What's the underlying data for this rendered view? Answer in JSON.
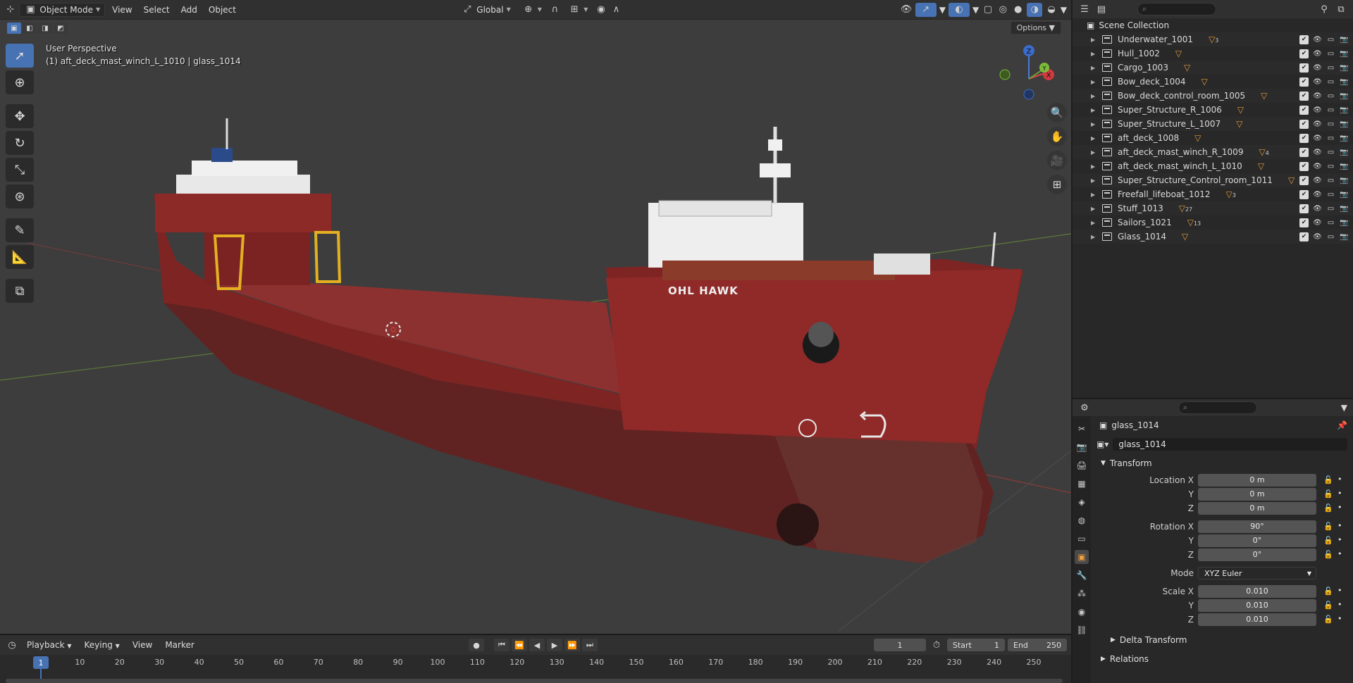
{
  "header": {
    "mode": "Object Mode",
    "menus": [
      "View",
      "Select",
      "Add",
      "Object"
    ],
    "orientation": "Global",
    "options": "Options"
  },
  "viewport": {
    "perspective": "User Perspective",
    "active_info": "(1) aft_deck_mast_winch_L_1010 | glass_1014",
    "ship_name": "OHL HAWK",
    "gizmo": {
      "x": "X",
      "y": "Y",
      "z": "Z"
    }
  },
  "outliner": {
    "search_placeholder": "",
    "root": "Scene Collection",
    "items": [
      {
        "name": "Underwater_1001",
        "count": "3"
      },
      {
        "name": "Hull_1002",
        "count": ""
      },
      {
        "name": "Cargo_1003",
        "count": ""
      },
      {
        "name": "Bow_deck_1004",
        "count": ""
      },
      {
        "name": "Bow_deck_control_room_1005",
        "count": ""
      },
      {
        "name": "Super_Structure_R_1006",
        "count": ""
      },
      {
        "name": "Super_Structure_L_1007",
        "count": ""
      },
      {
        "name": "aft_deck_1008",
        "count": ""
      },
      {
        "name": "aft_deck_mast_winch_R_1009",
        "count": "4"
      },
      {
        "name": "aft_deck_mast_winch_L_1010",
        "count": ""
      },
      {
        "name": "Super_Structure_Control_room_1011",
        "count": ""
      },
      {
        "name": "Freefall_lifeboat_1012",
        "count": "3"
      },
      {
        "name": "Stuff_1013",
        "count": "27"
      },
      {
        "name": "Sailors_1021",
        "count": "13"
      },
      {
        "name": "Glass_1014",
        "count": ""
      }
    ]
  },
  "properties": {
    "object_title": "glass_1014",
    "object_name": "glass_1014",
    "transform_label": "Transform",
    "location": {
      "label": "Location X",
      "x": "0 m",
      "y": "0 m",
      "z": "0 m"
    },
    "rotation": {
      "label": "Rotation X",
      "x": "90°",
      "y": "0°",
      "z": "0°"
    },
    "mode_label": "Mode",
    "mode_value": "XYZ Euler",
    "scale": {
      "label": "Scale X",
      "x": "0.010",
      "y": "0.010",
      "z": "0.010"
    },
    "axis": {
      "y": "Y",
      "z": "Z"
    },
    "delta_transform": "Delta Transform",
    "relations": "Relations"
  },
  "timeline": {
    "menus": [
      "Playback",
      "Keying",
      "View",
      "Marker"
    ],
    "current_frame": "1",
    "start_label": "Start",
    "start": "1",
    "end_label": "End",
    "end": "250",
    "playhead": "1",
    "ticks": [
      "10",
      "20",
      "30",
      "40",
      "50",
      "60",
      "70",
      "80",
      "90",
      "100",
      "110",
      "120",
      "130",
      "140",
      "150",
      "160",
      "170",
      "180",
      "190",
      "200",
      "210",
      "220",
      "230",
      "240",
      "250"
    ]
  },
  "colors": {
    "accent": "#4772b3",
    "hull": "#8a2a28",
    "mesh_icon": "#e39a3c",
    "viewport_bg": "#3d3d3d"
  }
}
